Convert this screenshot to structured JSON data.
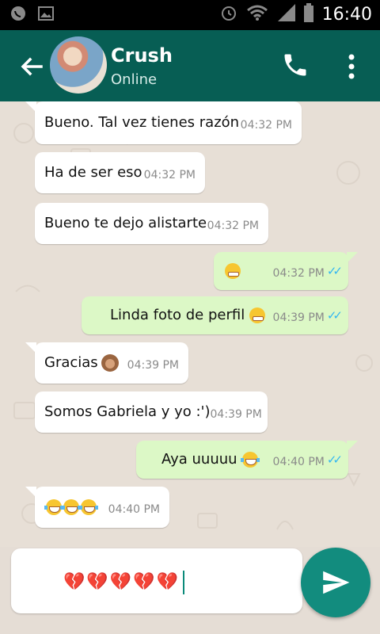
{
  "status_bar": {
    "time": "16:40"
  },
  "header": {
    "contact_name": "Crush",
    "contact_status": "Online"
  },
  "colors": {
    "appbar": "#075e54",
    "outgoing_bubble": "#dcf8c6",
    "incoming_bubble": "#ffffff",
    "read_ticks": "#34b7f1",
    "send_button": "#128c7e"
  },
  "icons": [
    "back-arrow-icon",
    "phone-icon",
    "more-vert-icon",
    "send-icon",
    "whatsapp-notification-icon",
    "gallery-icon",
    "alarm-icon",
    "wifi-icon",
    "signal-icon",
    "battery-icon"
  ],
  "messages": [
    {
      "direction": "incoming",
      "text": "Bueno. Tal vez tienes razón",
      "time": "04:32 PM"
    },
    {
      "direction": "incoming",
      "text": "Ha de ser eso",
      "time": "04:32 PM"
    },
    {
      "direction": "incoming",
      "text": "Bueno te dejo alistarte",
      "time": "04:32 PM"
    },
    {
      "direction": "outgoing",
      "text": "",
      "emoji": "grimacing",
      "time": "04:32 PM",
      "ticks": "✓✓"
    },
    {
      "direction": "outgoing",
      "text": "Linda foto de perfil",
      "emoji": "grimacing",
      "time": "04:39 PM",
      "ticks": "✓✓"
    },
    {
      "direction": "incoming",
      "text": "Gracias",
      "emoji": "see-no-evil-monkey",
      "time": "04:39 PM"
    },
    {
      "direction": "incoming",
      "text": "Somos Gabriela y yo :')",
      "time": "04:39 PM"
    },
    {
      "direction": "outgoing",
      "text": "Aya uuuuu",
      "emoji": "tears-of-joy",
      "time": "04:40 PM",
      "ticks": "✓✓"
    },
    {
      "direction": "incoming",
      "text": "",
      "emoji": "tears-of-joy x3",
      "time": "04:40 PM"
    }
  ],
  "composer": {
    "value": "💔💔💔💔💔"
  }
}
